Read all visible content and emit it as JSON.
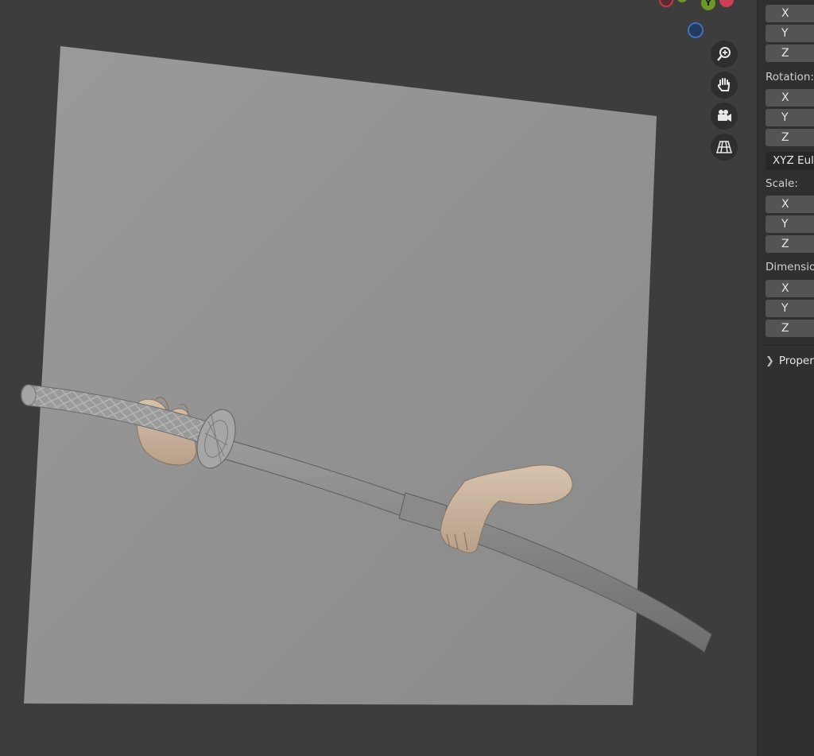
{
  "viewport": {
    "navigation": {
      "zoom_icon": "zoom-in-icon",
      "pan_icon": "hand-pan-icon",
      "camera_icon": "camera-icon",
      "ortho_icon": "grid-perspective-icon"
    },
    "gizmo": {
      "y_label": "Y",
      "colors": {
        "x": "#c43a4a",
        "y": "#6a9a23",
        "z": "#2f5fa8"
      }
    },
    "scene_objects": [
      "plane",
      "katana",
      "scabbard",
      "left-hand",
      "right-arm"
    ]
  },
  "sidebar": {
    "location": {
      "x": "X",
      "y": "Y",
      "z": "Z"
    },
    "rotation": {
      "label": "Rotation:",
      "x": "X",
      "y": "Y",
      "z": "Z",
      "mode": "XYZ Eule"
    },
    "scale": {
      "label": "Scale:",
      "x": "X",
      "y": "Y",
      "z": "Z"
    },
    "dimensions": {
      "label": "Dimensio",
      "x": "X",
      "y": "Y",
      "z": "Z"
    },
    "properties_panel": {
      "label": "Propert"
    }
  }
}
